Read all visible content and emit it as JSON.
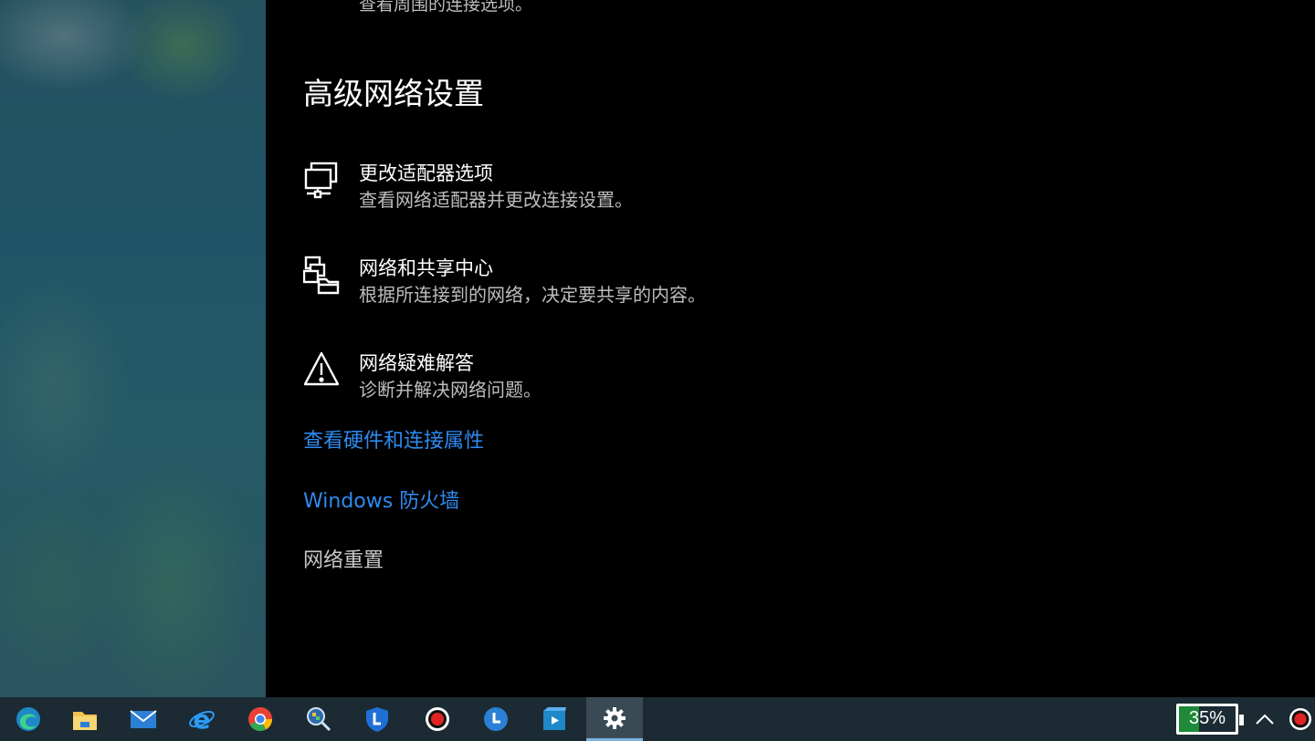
{
  "settings": {
    "cut_off_row": {
      "description": "查看周围的连接选项。"
    },
    "heading": "高级网络设置",
    "entries": [
      {
        "title": "更改适配器选项",
        "description": "查看网络适配器并更改连接设置。",
        "icon": "adapter-icon"
      },
      {
        "title": "网络和共享中心",
        "description": "根据所连接到的网络，决定要共享的内容。",
        "icon": "sharing-center-icon"
      },
      {
        "title": "网络疑难解答",
        "description": "诊断并解决网络问题。",
        "icon": "warning-icon"
      }
    ],
    "links": {
      "hardware_properties": "查看硬件和连接属性",
      "firewall": "Windows 防火墙",
      "network_reset": "网络重置"
    },
    "link_color": "#2e8bf0"
  },
  "taskbar": {
    "apps": [
      {
        "name": "edge-icon"
      },
      {
        "name": "file-explorer-icon"
      },
      {
        "name": "mail-icon"
      },
      {
        "name": "internet-explorer-icon"
      },
      {
        "name": "chrome-icon"
      },
      {
        "name": "search-tool-icon"
      },
      {
        "name": "shield-app-icon"
      },
      {
        "name": "record-icon"
      },
      {
        "name": "clock-app-icon"
      },
      {
        "name": "video-editor-icon"
      },
      {
        "name": "settings-gear-icon",
        "active": true
      }
    ],
    "battery_percent": "35%",
    "battery_level": 0.35
  }
}
